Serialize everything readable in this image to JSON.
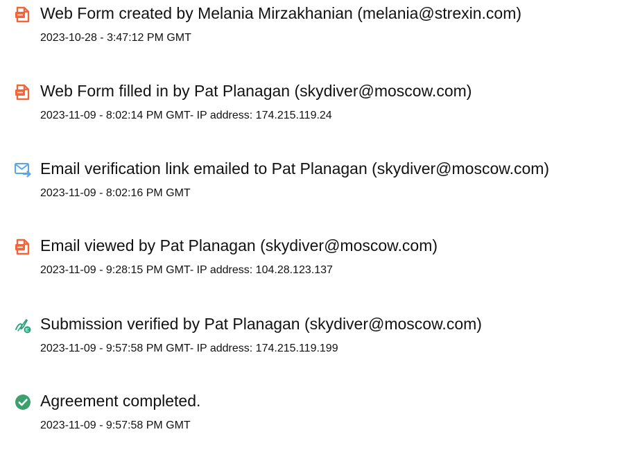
{
  "events": [
    {
      "icon": "document-icon",
      "title": "Web Form created by Melania Mirzakhanian (melania@strexin.com)",
      "timestamp": "2023-10-28 - 3:47:12 PM GMT"
    },
    {
      "icon": "document-icon",
      "title": "Web Form filled in by Pat Planagan (skydiver@moscow.com)",
      "timestamp": "2023-11-09 - 8:02:14 PM GMT- IP address: 174.215.119.24"
    },
    {
      "icon": "email-forward-icon",
      "title": "Email verification link emailed to Pat Planagan (skydiver@moscow.com)",
      "timestamp": "2023-11-09 - 8:02:16 PM GMT"
    },
    {
      "icon": "document-icon",
      "title": "Email viewed by Pat Planagan (skydiver@moscow.com)",
      "timestamp": "2023-11-09 - 9:28:15 PM GMT- IP address: 104.28.123.137"
    },
    {
      "icon": "signature-verified-icon",
      "title": "Submission verified by Pat Planagan (skydiver@moscow.com)",
      "timestamp": "2023-11-09 - 9:57:58 PM GMT- IP address: 174.215.119.199"
    },
    {
      "icon": "check-circle-icon",
      "title": "Agreement completed.",
      "timestamp": "2023-11-09 - 9:57:58 PM GMT"
    }
  ],
  "colors": {
    "document_icon": "#f2643a",
    "email_icon": "#5aa6e3",
    "signature_icon": "#2ea37a",
    "check_icon": "#3c9f6e"
  }
}
